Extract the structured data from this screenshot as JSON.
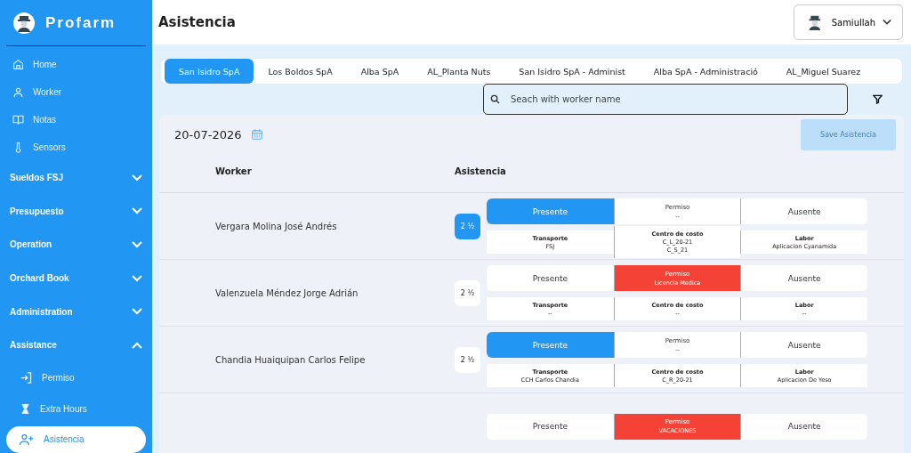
{
  "sidebar": {
    "brand": "Profarm",
    "items": [
      {
        "kind": "link",
        "label": "Home",
        "selected": false
      },
      {
        "kind": "link",
        "label": "Worker",
        "selected": false
      },
      {
        "kind": "link",
        "label": "Notas",
        "selected": false
      },
      {
        "kind": "link",
        "label": "Sensors",
        "selected": false
      },
      {
        "kind": "group",
        "label": "Sueldos FSJ",
        "expanded": false
      },
      {
        "kind": "group",
        "label": "Presupuesto",
        "expanded": false
      },
      {
        "kind": "group",
        "label": "Operation",
        "expanded": false
      },
      {
        "kind": "group",
        "label": "Orchard Book",
        "expanded": false
      },
      {
        "kind": "group",
        "label": "Administration",
        "expanded": false
      },
      {
        "kind": "group",
        "label": "Assistance",
        "expanded": true,
        "children": [
          {
            "label": "Permiso",
            "selected": false
          },
          {
            "label": "Extra Hours",
            "selected": false
          },
          {
            "label": "Asistencia",
            "selected": true
          }
        ]
      }
    ]
  },
  "header": {
    "title": "Asistencia",
    "user": "Samiullah"
  },
  "tabs": [
    {
      "label": "San Isidro SpA",
      "selected": true
    },
    {
      "label": "Los Boldos SpA",
      "selected": false
    },
    {
      "label": "Alba SpA",
      "selected": false
    },
    {
      "label": "AL_Planta Nuts",
      "selected": false
    },
    {
      "label": "San Isidro SpA - Administ",
      "selected": false
    },
    {
      "label": "Alba SpA - Administració",
      "selected": false
    },
    {
      "label": "AL_Miguel Suarez",
      "selected": false
    }
  ],
  "search": {
    "placeholder": "Seach with worker name"
  },
  "attendance": {
    "date": "20-07-2026",
    "save_button": {
      "label": "Save Asistencia",
      "disabled": true
    },
    "columns": [
      "Worker",
      "Asistencia"
    ],
    "rows": [
      {
        "worker": "Vergara Molina José Andrés",
        "half_day": {
          "label": "2 ½",
          "selected": true
        },
        "options": [
          {
            "kind": "presente",
            "label": "Presente",
            "selected": true
          },
          {
            "kind": "permiso",
            "label": "Permiso",
            "detail": "--",
            "selected": false
          },
          {
            "kind": "ausente",
            "label": "Ausente",
            "selected": false
          }
        ],
        "details": [
          {
            "label": "Transporte",
            "values": [
              "FSJ"
            ]
          },
          {
            "label": "Centro de costo",
            "values": [
              "C_L_20-21",
              "C_S_21"
            ]
          },
          {
            "label": "Labor",
            "values": [
              "Aplicacion Cyanamida"
            ]
          }
        ]
      },
      {
        "worker": "Valenzuela Méndez Jorge Adrián",
        "half_day": {
          "label": "2 ½",
          "selected": false
        },
        "options": [
          {
            "kind": "presente",
            "label": "Presente",
            "selected": false
          },
          {
            "kind": "permiso",
            "label": "Permiso",
            "detail": "Licencia Medica",
            "selected": true
          },
          {
            "kind": "ausente",
            "label": "Ausente",
            "selected": false
          }
        ],
        "details": [
          {
            "label": "Transporte",
            "values": [
              "--"
            ]
          },
          {
            "label": "Centro de costo",
            "values": [
              "--"
            ]
          },
          {
            "label": "Labor",
            "values": [
              "--"
            ]
          }
        ]
      },
      {
        "worker": "Chandia Huaiquipan Carlos Felipe",
        "half_day": {
          "label": "2 ½",
          "selected": false
        },
        "options": [
          {
            "kind": "presente",
            "label": "Presente",
            "selected": true
          },
          {
            "kind": "permiso",
            "label": "Permiso",
            "detail": "--",
            "selected": false
          },
          {
            "kind": "ausente",
            "label": "Ausente",
            "selected": false
          }
        ],
        "details": [
          {
            "label": "Transporte",
            "values": [
              "CCH Carlos Chandia"
            ]
          },
          {
            "label": "Centro de costo",
            "values": [
              "C_R_20-21"
            ]
          },
          {
            "label": "Labor",
            "values": [
              "Aplicacion De Yeso"
            ]
          }
        ]
      },
      {
        "options": [
          {
            "kind": "presente",
            "label": "Presente",
            "selected": false
          },
          {
            "kind": "permiso",
            "label": "Permiso",
            "detail": "VACACIONES",
            "selected": true
          },
          {
            "kind": "ausente",
            "label": "Ausente",
            "selected": false
          }
        ]
      }
    ]
  }
}
